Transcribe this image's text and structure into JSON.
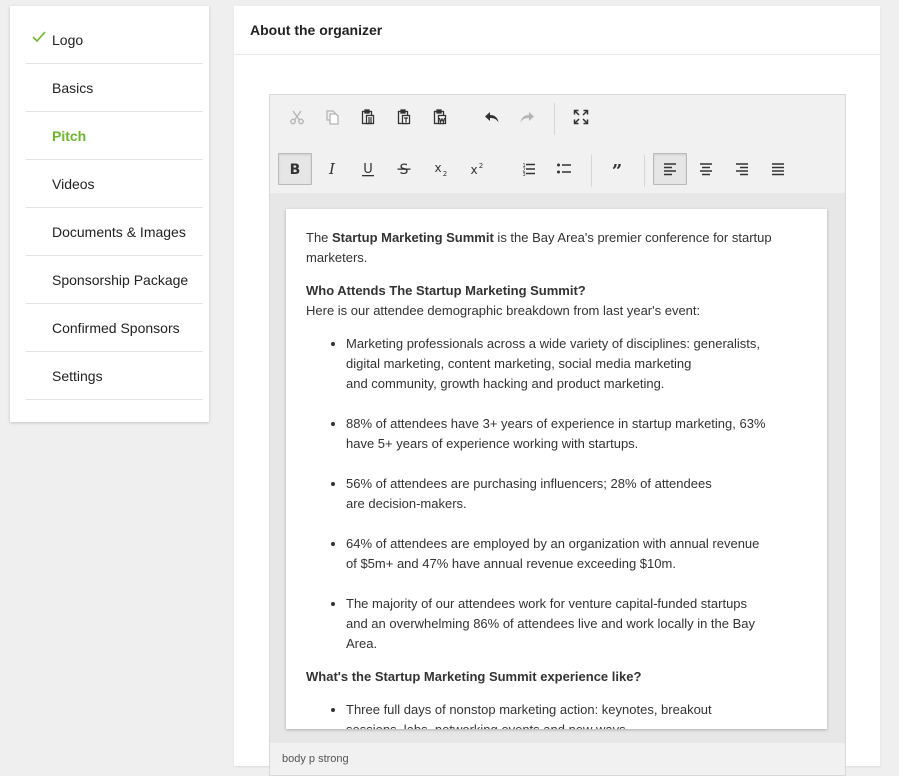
{
  "sidebar": {
    "items": [
      {
        "label": "Logo",
        "completed": true
      },
      {
        "label": "Basics"
      },
      {
        "label": "Pitch",
        "active": true
      },
      {
        "label": "Videos"
      },
      {
        "label": "Documents & Images"
      },
      {
        "label": "Sponsorship Package"
      },
      {
        "label": "Confirmed Sponsors"
      },
      {
        "label": "Settings"
      }
    ]
  },
  "panel": {
    "title": "About the organizer"
  },
  "toolbar": {
    "row1": [
      "cut-icon",
      "copy-icon",
      "paste-icon",
      "paste-text-icon",
      "paste-word-icon",
      "undo-icon",
      "redo-icon",
      "maximize-icon"
    ],
    "row2": [
      "bold-icon",
      "italic-icon",
      "underline-icon",
      "strikethrough-icon",
      "subscript-icon",
      "superscript-icon",
      "numbered-list-icon",
      "bulleted-list-icon",
      "blockquote-icon",
      "align-left-icon",
      "align-center-icon",
      "align-right-icon",
      "justify-icon"
    ]
  },
  "content": {
    "intro_pre": "The ",
    "intro_bold": "Startup Marketing Summit",
    "intro_post": " is the Bay Area's premier conference for startup marketers.",
    "heading1": "Who Attends The Startup Marketing Summit?",
    "sub1": "Here is our attendee demographic breakdown from last year's event:",
    "bullets1": [
      [
        "Marketing professionals across a wide variety of disciplines: generalists,",
        "digital marketing, content marketing, social media marketing",
        "and community, growth hacking and product marketing."
      ],
      [
        "88% of attendees have 3+ years of experience in startup marketing, 63%",
        "have 5+ years of experience working with startups."
      ],
      [
        "56% of attendees are purchasing influencers; 28% of attendees",
        "are decision-makers."
      ],
      [
        "64% of attendees are employed by an organization with annual revenue",
        "of $5m+ and 47% have annual revenue exceeding $10m."
      ],
      [
        "The majority of our attendees work for venture capital-funded startups",
        "and an overwhelming 86% of attendees live and work locally in the Bay",
        "Area."
      ]
    ],
    "heading2": "What's the Startup Marketing Summit experience like?",
    "bullets2": [
      [
        "Three full days of nonstop marketing action: keynotes, breakout",
        "sessions, labs, networking events and new ways"
      ]
    ]
  },
  "status": {
    "path": "body  p  strong"
  },
  "colors": {
    "accent": "#6cb52d",
    "icon": "#333333",
    "icon_disabled": "#b5b5b5"
  }
}
